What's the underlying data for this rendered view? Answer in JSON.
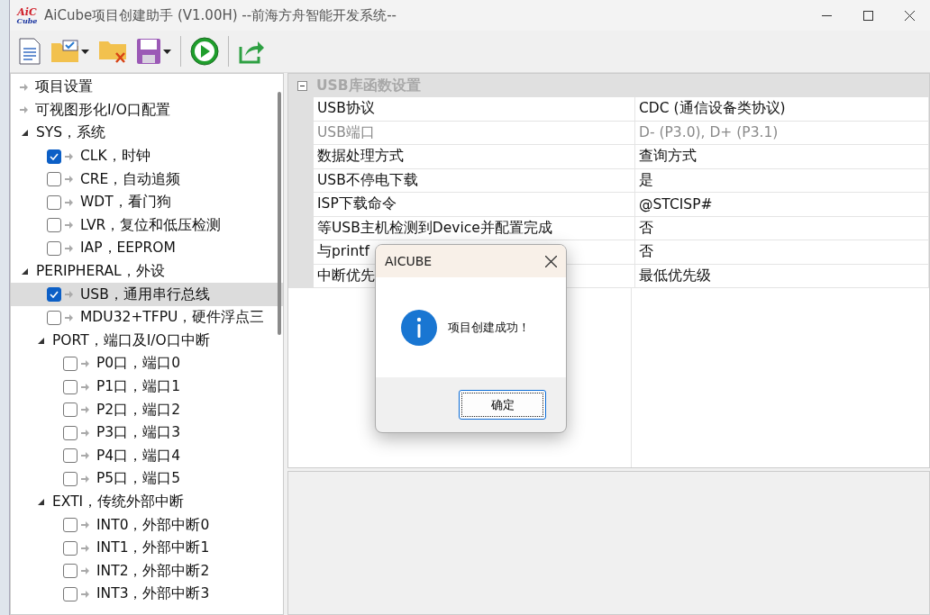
{
  "window": {
    "logo_top": "AiC",
    "logo_bottom": "Cube",
    "title": "AiCube项目创建助手 (V1.00H) --前海方舟智能开发系统--"
  },
  "toolbar": [
    {
      "kind": "new"
    },
    {
      "kind": "open",
      "dropdown": true
    },
    {
      "kind": "close"
    },
    {
      "kind": "save",
      "dropdown": true
    },
    {
      "kind": "sep"
    },
    {
      "kind": "run"
    },
    {
      "kind": "sep"
    },
    {
      "kind": "export"
    }
  ],
  "tree": [
    {
      "kind": "leaf",
      "label": "项目设置"
    },
    {
      "kind": "leaf",
      "label": "可视图形化I/O口配置"
    },
    {
      "kind": "group",
      "label": "SYS，系统",
      "expanded": true,
      "children": [
        {
          "kind": "check",
          "label": "CLK，时钟",
          "checked": true,
          "selected": false
        },
        {
          "kind": "check",
          "label": "CRE，自动追频",
          "checked": false,
          "selected": false
        },
        {
          "kind": "check",
          "label": "WDT，看门狗",
          "checked": false,
          "selected": false
        },
        {
          "kind": "check",
          "label": "LVR，复位和低压检测",
          "checked": false,
          "selected": false
        },
        {
          "kind": "check",
          "label": "IAP，EEPROM",
          "checked": false,
          "selected": false
        }
      ]
    },
    {
      "kind": "group",
      "label": "PERIPHERAL，外设",
      "expanded": true,
      "children": [
        {
          "kind": "check",
          "label": "USB，通用串行总线",
          "checked": true,
          "selected": true
        },
        {
          "kind": "check",
          "label": "MDU32+TFPU，硬件浮点三",
          "checked": false,
          "selected": false
        },
        {
          "kind": "group",
          "label": "PORT，端口及I/O口中断",
          "expanded": true,
          "children": [
            {
              "kind": "check",
              "label": "P0口，端口0",
              "checked": false,
              "selected": false
            },
            {
              "kind": "check",
              "label": "P1口，端口1",
              "checked": false,
              "selected": false
            },
            {
              "kind": "check",
              "label": "P2口，端口2",
              "checked": false,
              "selected": false
            },
            {
              "kind": "check",
              "label": "P3口，端口3",
              "checked": false,
              "selected": false
            },
            {
              "kind": "check",
              "label": "P4口，端口4",
              "checked": false,
              "selected": false
            },
            {
              "kind": "check",
              "label": "P5口，端口5",
              "checked": false,
              "selected": false
            }
          ]
        },
        {
          "kind": "group",
          "label": "EXTI，传统外部中断",
          "expanded": true,
          "children": [
            {
              "kind": "check",
              "label": "INT0，外部中断0",
              "checked": false,
              "selected": false
            },
            {
              "kind": "check",
              "label": "INT1，外部中断1",
              "checked": false,
              "selected": false
            },
            {
              "kind": "check",
              "label": "INT2，外部中断2",
              "checked": false,
              "selected": false
            },
            {
              "kind": "check",
              "label": "INT3，外部中断3",
              "checked": false,
              "selected": false
            }
          ]
        }
      ]
    }
  ],
  "properties": {
    "section": "USB库函数设置",
    "expanded": true,
    "rows": [
      {
        "name": "USB协议",
        "value": "CDC (通信设备类协议)",
        "disabled": false
      },
      {
        "name": "USB端口",
        "value": "D- (P3.0), D+ (P3.1)",
        "disabled": true
      },
      {
        "name": "数据处理方式",
        "value": "查询方式",
        "disabled": false
      },
      {
        "name": "USB不停电下载",
        "value": "是",
        "disabled": false
      },
      {
        "name": "ISP下载命令",
        "value": "@STCISP#",
        "disabled": false
      },
      {
        "name": "等USB主机检测到Device并配置完成",
        "value": "否",
        "disabled": false
      },
      {
        "name": "与printf",
        "value": "否",
        "disabled": false
      },
      {
        "name": "中断优先",
        "value": "最低优先级",
        "disabled": false
      }
    ]
  },
  "dialog": {
    "title": "AICUBE",
    "message": "项目创建成功！",
    "button": "确定"
  }
}
